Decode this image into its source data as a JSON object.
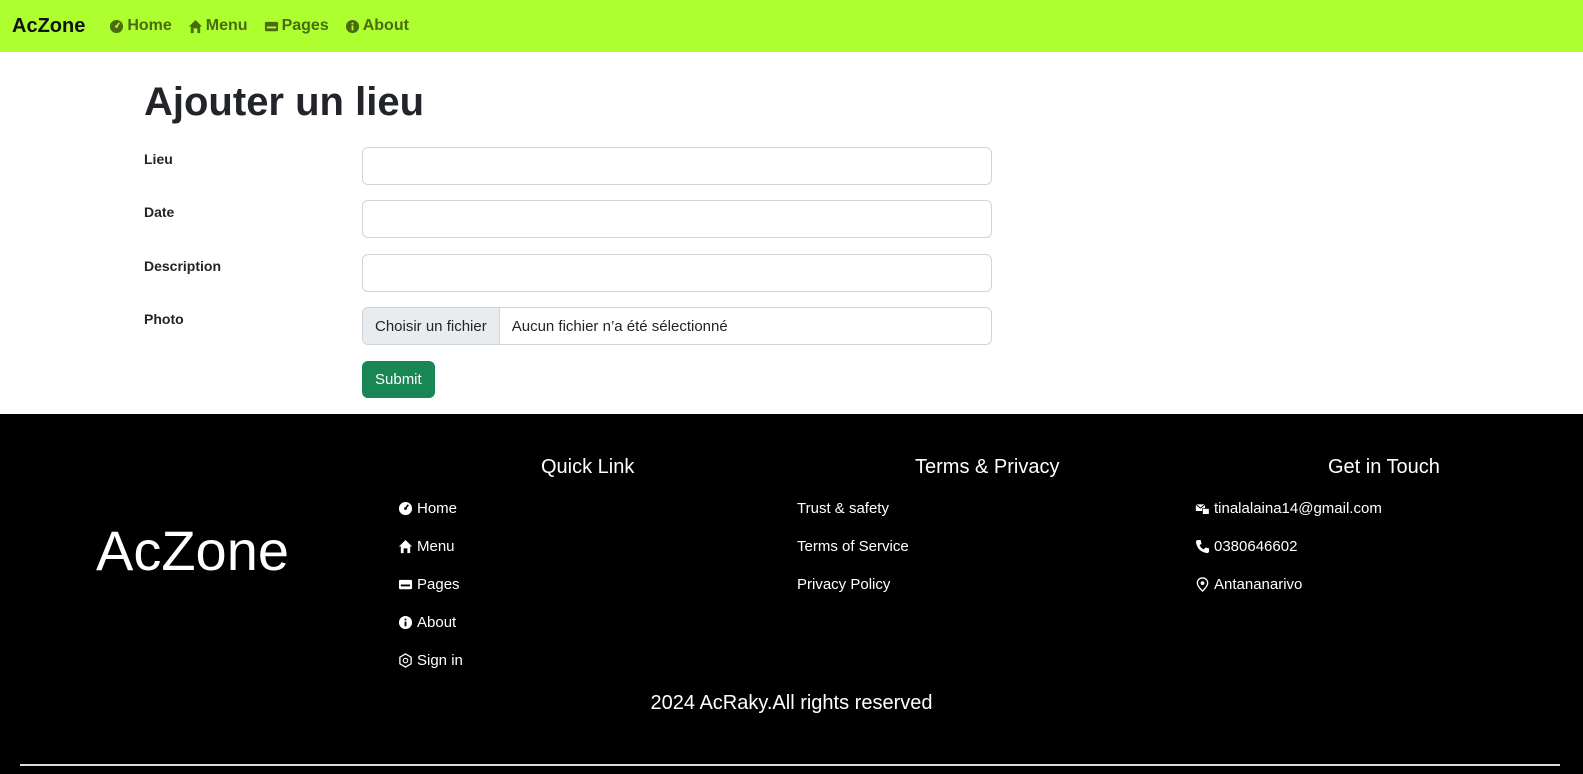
{
  "navbar": {
    "brand": "AcZone",
    "links": [
      {
        "label": "Home",
        "icon": "dashboard-icon"
      },
      {
        "label": "Menu",
        "icon": "house-icon"
      },
      {
        "label": "Pages",
        "icon": "card-icon"
      },
      {
        "label": "About",
        "icon": "info-icon"
      }
    ]
  },
  "form": {
    "title": "Ajouter un lieu",
    "fields": [
      {
        "label": "Lieu",
        "value": ""
      },
      {
        "label": "Date",
        "value": ""
      },
      {
        "label": "Description",
        "value": ""
      }
    ],
    "photo_label": "Photo",
    "file_button": "Choisir un fichier",
    "file_status": "Aucun fichier n’a été sélectionné",
    "submit_label": "Submit"
  },
  "footer": {
    "brand": "AcZone",
    "quick_link_title": "Quick Link",
    "quick_links": [
      {
        "label": "Home",
        "icon": "dashboard-icon"
      },
      {
        "label": "Menu",
        "icon": "house-icon"
      },
      {
        "label": "Pages",
        "icon": "card-icon"
      },
      {
        "label": "About",
        "icon": "info-icon"
      },
      {
        "label": "Sign in",
        "icon": "sign-in-icon"
      }
    ],
    "terms_title": "Terms & Privacy",
    "terms_links": [
      "Trust & safety",
      "Terms of Service",
      "Privacy Policy"
    ],
    "contact_title": "Get in Touch",
    "contacts": [
      {
        "label": "tinalalaina14@gmail.com",
        "icon": "mail-icon"
      },
      {
        "label": "0380646602",
        "icon": "phone-icon"
      },
      {
        "label": "Antananarivo",
        "icon": "location-icon"
      }
    ],
    "copyright": "2024 AcRaky.All rights reserved"
  },
  "colors": {
    "navbar_bg": "#adff2f",
    "nav_link": "#4a6b0f",
    "submit_bg": "#198754",
    "footer_bg": "#000000"
  }
}
